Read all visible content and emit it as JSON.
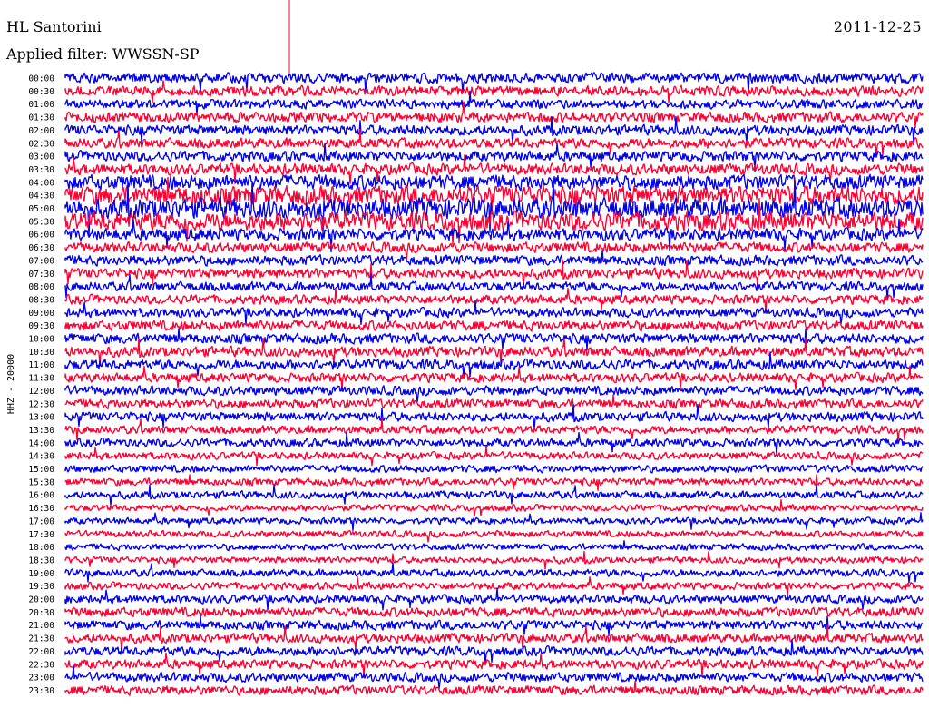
{
  "header": {
    "station": "HL Santorini",
    "date": "2011-12-25",
    "filter_text": "Applied filter: WWSSN-SP"
  },
  "chart_data": {
    "type": "line",
    "title": "HL Santorini",
    "subtitle": "Applied filter: WWSSN-SP",
    "date": "2011-12-25",
    "ylabel": "HHZ - 20000",
    "xlabel": "",
    "trace_colors": [
      "#0000ee",
      "#ff0033"
    ],
    "row_labels": [
      "00:00",
      "00:30",
      "01:00",
      "01:30",
      "02:00",
      "02:30",
      "03:00",
      "03:30",
      "04:00",
      "04:30",
      "05:00",
      "05:30",
      "06:00",
      "06:30",
      "07:00",
      "07:30",
      "08:00",
      "08:30",
      "09:00",
      "09:30",
      "10:00",
      "10:30",
      "11:00",
      "11:30",
      "12:00",
      "12:30",
      "13:00",
      "13:30",
      "14:00",
      "14:30",
      "15:00",
      "15:30",
      "16:00",
      "16:30",
      "17:00",
      "17:30",
      "18:00",
      "18:30",
      "19:00",
      "19:30",
      "20:00",
      "20:30",
      "21:00",
      "21:30",
      "22:00",
      "22:30",
      "23:00",
      "23:30"
    ],
    "row_amplitude": [
      0.55,
      0.55,
      0.5,
      0.55,
      0.55,
      0.55,
      0.55,
      0.6,
      0.8,
      1.0,
      1.1,
      1.0,
      0.65,
      0.55,
      0.55,
      0.55,
      0.5,
      0.5,
      0.5,
      0.55,
      0.55,
      0.55,
      0.55,
      0.5,
      0.5,
      0.5,
      0.5,
      0.45,
      0.45,
      0.4,
      0.4,
      0.4,
      0.4,
      0.35,
      0.35,
      0.35,
      0.35,
      0.35,
      0.4,
      0.4,
      0.45,
      0.5,
      0.5,
      0.5,
      0.5,
      0.5,
      0.5,
      0.5
    ],
    "grid": false
  }
}
